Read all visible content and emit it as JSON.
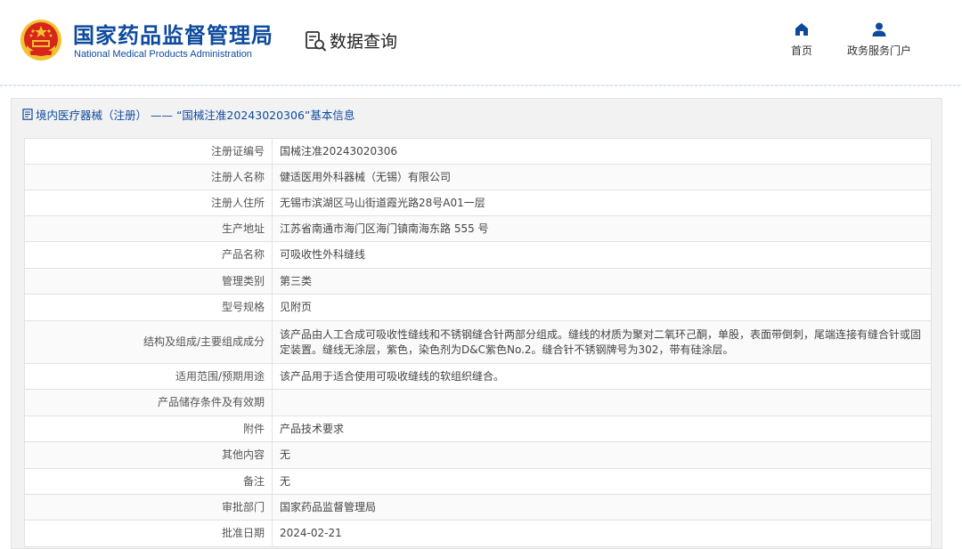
{
  "header": {
    "org_name_cn": "国家药品监督管理局",
    "org_name_en": "National Medical Products Administration",
    "query_title": "数据查询",
    "nav": [
      {
        "label": "首页",
        "icon": "home-icon"
      },
      {
        "label": "政务服务门户",
        "icon": "user-icon"
      }
    ]
  },
  "panel": {
    "breadcrumb": "境内医疗器械（注册） —— “国械注准20243020306”基本信息"
  },
  "details": [
    {
      "key": "注册证编号",
      "value": "国械注准20243020306"
    },
    {
      "key": "注册人名称",
      "value": "健适医用外科器械（无锡）有限公司"
    },
    {
      "key": "注册人住所",
      "value": "无锡市滨湖区马山街道霞光路28号A01一层"
    },
    {
      "key": "生产地址",
      "value": "江苏省南通市海门区海门镇南海东路 555 号"
    },
    {
      "key": "产品名称",
      "value": "可吸收性外科缝线"
    },
    {
      "key": "管理类别",
      "value": "第三类"
    },
    {
      "key": "型号规格",
      "value": "见附页"
    },
    {
      "key": "结构及组成/主要组成成分",
      "value": "该产品由人工合成可吸收性缝线和不锈钢缝合针两部分组成。缝线的材质为聚对二氧环己酮，单股，表面带倒刺，尾端连接有缝合针或固定装置。缝线无涂层，紫色，染色剂为D&C紫色No.2。缝合针不锈钢牌号为302，带有硅涂层。"
    },
    {
      "key": "适用范围/预期用途",
      "value": "该产品用于适合使用可吸收缝线的软组织缝合。"
    },
    {
      "key": "产品储存条件及有效期",
      "value": ""
    },
    {
      "key": "附件",
      "value": "产品技术要求"
    },
    {
      "key": "其他内容",
      "value": "无"
    },
    {
      "key": "备注",
      "value": "无"
    },
    {
      "key": "审批部门",
      "value": "国家药品监督管理局"
    },
    {
      "key": "批准日期",
      "value": "2024-02-21"
    }
  ],
  "colors": {
    "brand_blue": "#0d4a9e",
    "emblem_red": "#d8261c",
    "emblem_gold": "#f2c230"
  }
}
